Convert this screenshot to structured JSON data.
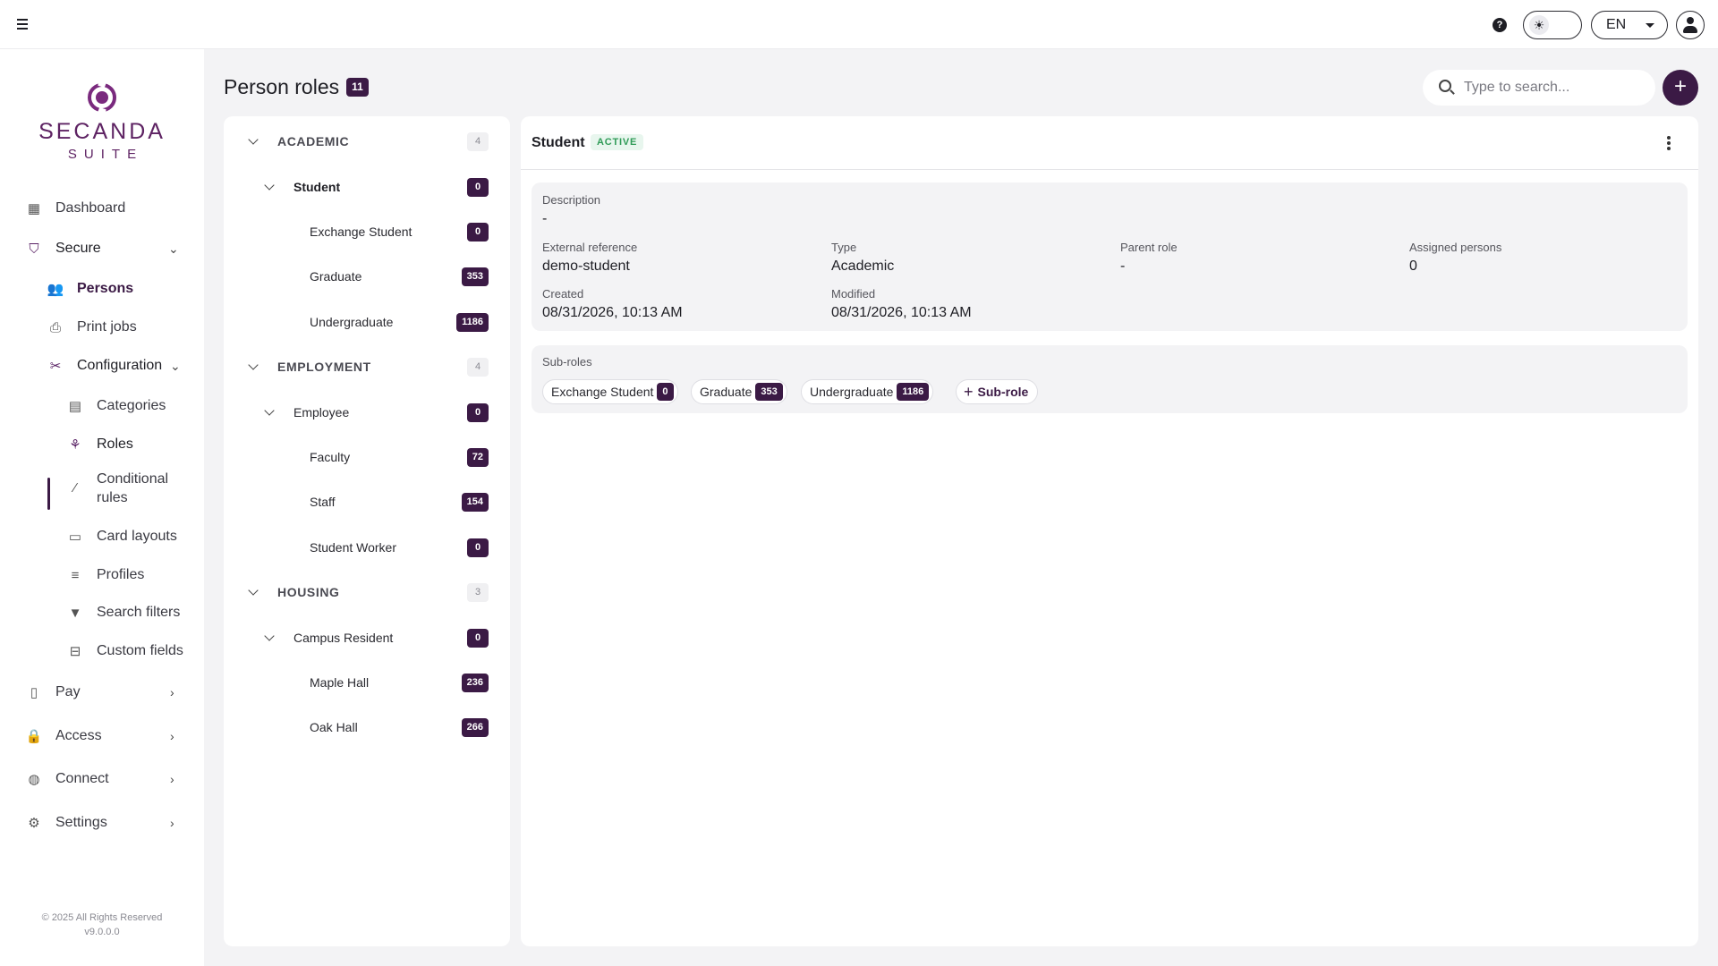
{
  "topbar": {
    "help_icon": "help-circle-icon",
    "theme_icon": "sun-icon",
    "language": "EN"
  },
  "brand": {
    "name": "SECANDA",
    "sub": "SUITE",
    "color": "#7a2a7e"
  },
  "sidebar": {
    "items": [
      {
        "label": "Dashboard",
        "icon": "dashboard-icon"
      },
      {
        "label": "Secure",
        "icon": "shield-icon"
      },
      {
        "label": "Persons",
        "icon": "people-icon"
      },
      {
        "label": "Print jobs",
        "icon": "printer-icon"
      },
      {
        "label": "Configuration",
        "icon": "tools-icon"
      },
      {
        "label": "Categories",
        "icon": "table-icon"
      },
      {
        "label": "Roles",
        "icon": "hierarchy-icon"
      },
      {
        "label": "Conditional rules",
        "icon": "magic-wand-icon"
      },
      {
        "label": "Card layouts",
        "icon": "id-card-icon"
      },
      {
        "label": "Profiles",
        "icon": "sliders-icon"
      },
      {
        "label": "Search filters",
        "icon": "filter-icon"
      },
      {
        "label": "Custom fields",
        "icon": "text-field-icon"
      },
      {
        "label": "Pay",
        "icon": "pay-terminal-icon"
      },
      {
        "label": "Access",
        "icon": "lock-icon"
      },
      {
        "label": "Connect",
        "icon": "globe-icon"
      },
      {
        "label": "Settings",
        "icon": "gear-icon"
      }
    ],
    "copyright": "© 2025 All Rights Reserved",
    "version": "v9.0.0.0"
  },
  "page": {
    "title": "Person roles",
    "count": "11",
    "search_placeholder": "Type to search...",
    "accent": "#3b1a45"
  },
  "tree": {
    "rows": [
      {
        "label": "ACADEMIC",
        "count": "4"
      },
      {
        "label": "Student",
        "count": "0"
      },
      {
        "label": "Exchange Student",
        "count": "0"
      },
      {
        "label": "Graduate",
        "count": "353"
      },
      {
        "label": "Undergraduate",
        "count": "1186"
      },
      {
        "label": "EMPLOYMENT",
        "count": "4"
      },
      {
        "label": "Employee",
        "count": "0"
      },
      {
        "label": "Faculty",
        "count": "72"
      },
      {
        "label": "Staff",
        "count": "154"
      },
      {
        "label": "Student Worker",
        "count": "0"
      },
      {
        "label": "HOUSING",
        "count": "3"
      },
      {
        "label": "Campus Resident",
        "count": "0"
      },
      {
        "label": "Maple Hall",
        "count": "236"
      },
      {
        "label": "Oak Hall",
        "count": "266"
      }
    ]
  },
  "detail": {
    "title": "Student",
    "status": "ACTIVE",
    "status_color": "#2f9b57",
    "fields": {
      "description_label": "Description",
      "description_value": "-",
      "external_ref_label": "External reference",
      "external_ref_value": "demo-student",
      "type_label": "Type",
      "type_value": "Academic",
      "parent_label": "Parent role",
      "parent_value": "-",
      "assigned_label": "Assigned persons",
      "assigned_value": "0",
      "created_label": "Created",
      "created_value": "08/31/2026, 10:13 AM",
      "modified_label": "Modified",
      "modified_value": "08/31/2026, 10:13 AM"
    },
    "subroles_label": "Sub-roles",
    "subroles": [
      {
        "label": "Exchange Student",
        "count": "0"
      },
      {
        "label": "Graduate",
        "count": "353"
      },
      {
        "label": "Undergraduate",
        "count": "1186"
      }
    ],
    "add_subrole": "Sub-role"
  }
}
